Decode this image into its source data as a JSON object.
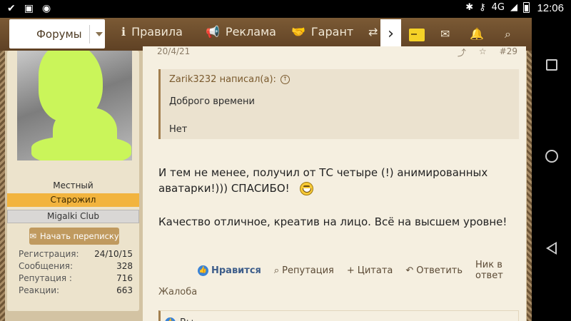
{
  "statusbar": {
    "left_icons": [
      "check-icon",
      "image-icon",
      "timer-icon"
    ],
    "network": "4G",
    "time": "12:06"
  },
  "nav": {
    "forum_select": "Форумы",
    "links": [
      "Правила",
      "Реклама",
      "Гарант"
    ],
    "more": "›"
  },
  "user": {
    "title": "Местный",
    "rank": "Старожил",
    "group": "Migalki Club",
    "start_convo": "Начать переписку",
    "stats": [
      {
        "label": "Регистрация:",
        "value": "24/10/15"
      },
      {
        "label": "Сообщения:",
        "value": "328"
      },
      {
        "label": "Репутация :",
        "value": "716"
      },
      {
        "label": "Реакции:",
        "value": "663"
      }
    ]
  },
  "post": {
    "date": "20/4/21",
    "number": "#29",
    "quote": {
      "author": "Zarik3232 написал(а):",
      "line1": "Доброго времени",
      "line2": "Нет"
    },
    "text1a": "И тем не менее, получил от ТС четыре (!) анимированных",
    "text1b": "аватарки!))) СПАСИБО!",
    "text2": "Качество отличное, креатив на лицо. Всё на высшем уровне!",
    "actions": {
      "like": "Нравится",
      "reputation": "Репутация",
      "quote": "Цитата",
      "reply": "Ответить",
      "nick": "Ник в ответ"
    },
    "report": "Жалоба",
    "likes_by": "Вы"
  },
  "colors": {
    "nav_bg": "#6b4b2b",
    "post_bg": "#f5efe0",
    "rank_badge": "#f2b43e",
    "accent": "#a27f4f"
  }
}
